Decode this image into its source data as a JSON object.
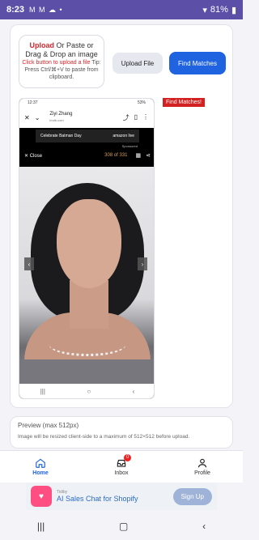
{
  "status": {
    "time": "8:23",
    "icons": "M M ☁ •",
    "wifi": "📶",
    "battery": "81%"
  },
  "upload": {
    "line1_a": "Upload",
    "line1_b": " Or Paste or Drag & Drop an image",
    "hint_red": "Click button to upload a file",
    "hint": " Tip: Press Ctrl/⌘+V to paste from clipboard."
  },
  "buttons": {
    "upload_file": "Upload File",
    "find_matches": "Find Matches"
  },
  "badge": "Find Matches!",
  "screenshot": {
    "status_time": "12:37",
    "status_right": "53%",
    "title_name": "Ziyi Zhang",
    "title_url": "imdb.com",
    "close": "Close",
    "counter": "308 of 331",
    "ad_left": "Celebrate Batman Day",
    "ad_right": "amazon live",
    "sponsored": "Sponsored"
  },
  "preview": {
    "title": "Preview (max 512px)",
    "desc": "Image will be resized client-side to a maximum of 512×512 before upload."
  },
  "tabs": [
    {
      "label": "Home",
      "active": true
    },
    {
      "label": "Inbox",
      "badge": "0"
    },
    {
      "label": "Profile"
    }
  ],
  "ad": {
    "brand": "Tidiby",
    "message": "AI Sales Chat for Shopify",
    "cta": "Sign Up"
  }
}
